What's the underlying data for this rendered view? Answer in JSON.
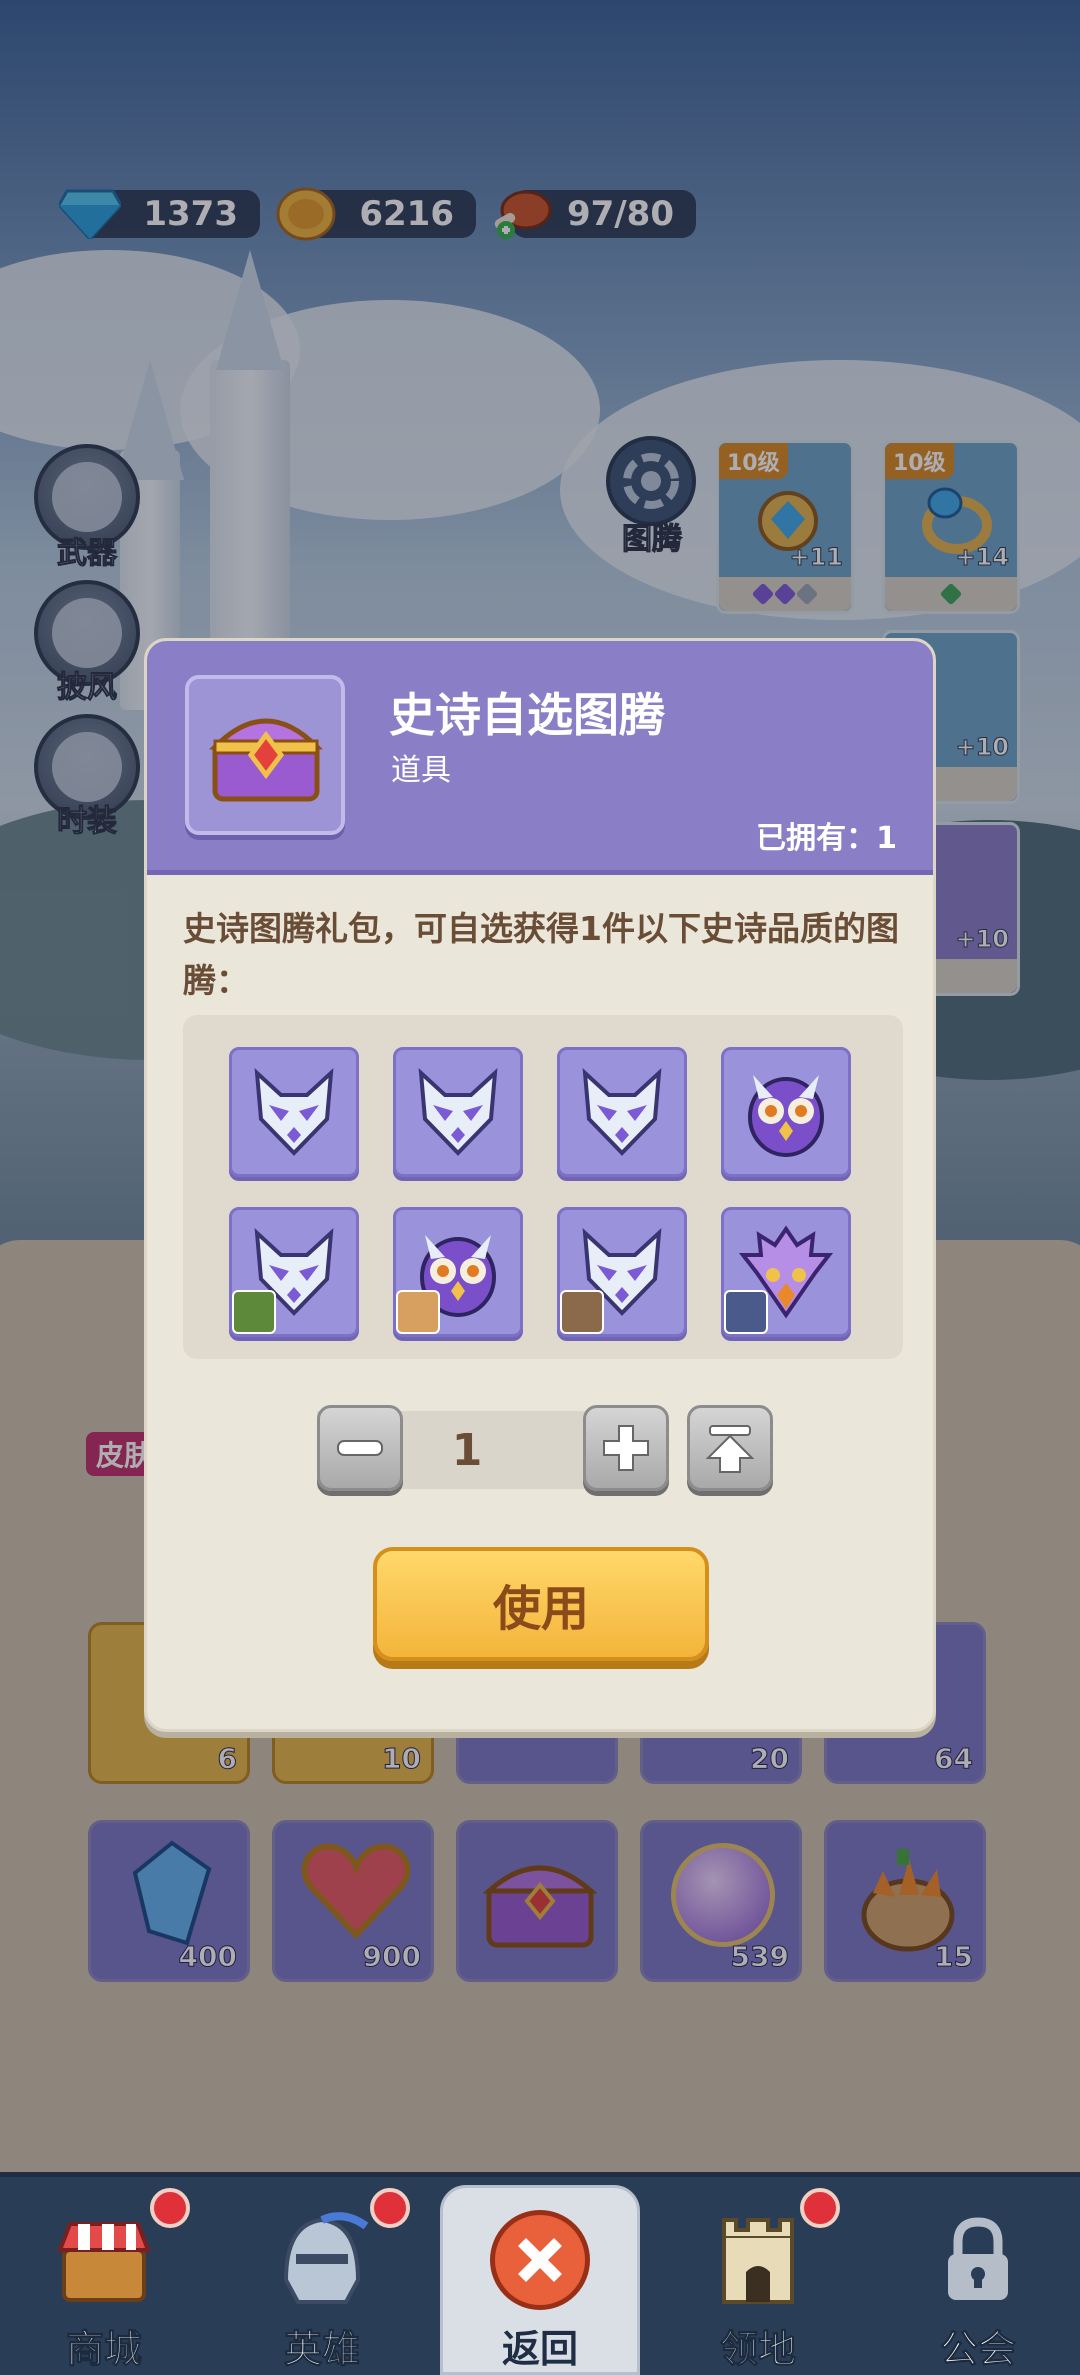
{
  "currency": {
    "diamonds": "1373",
    "coins": "6216",
    "stamina": "97/80"
  },
  "side_menu": [
    {
      "label": "武器",
      "icon": "weapon-icon"
    },
    {
      "label": "披风",
      "icon": "cape-icon"
    },
    {
      "label": "时装",
      "icon": "costume-icon"
    }
  ],
  "totem_button": {
    "label": "图腾",
    "icon": "totem-icon"
  },
  "equipment": [
    {
      "level": "10级",
      "plus": "+11",
      "gems": [
        "#7e5ad6",
        "#7e5ad6",
        "#9aa6b6"
      ]
    },
    {
      "level": "10级",
      "plus": "+14",
      "gems": [
        "#3fa55a"
      ]
    },
    {
      "plus": "+10"
    },
    {
      "plus": "+10"
    }
  ],
  "inventory_visible_counts": [
    "6",
    "10",
    "20",
    "64",
    "400",
    "900",
    "539",
    "15"
  ],
  "inventory_tag": "皮肤",
  "dialog": {
    "title": "史诗自选图腾",
    "subtitle": "道具",
    "owned_label": "已拥有：",
    "owned_value": "1",
    "description": "史诗图腾礼包，可自选获得1件以下史诗品质的图腾：",
    "quantity": "1",
    "use_label": "使用",
    "options": [
      {
        "icon": "fox-mask-icon"
      },
      {
        "icon": "fox-mask-icon"
      },
      {
        "icon": "fox-mask-icon"
      },
      {
        "icon": "owl-mask-icon"
      },
      {
        "icon": "fox-mask-icon",
        "hero": "goblin-hero-avatar"
      },
      {
        "icon": "owl-mask-icon",
        "hero": "lion-hero-avatar"
      },
      {
        "icon": "fox-mask-icon",
        "hero": "raccoon-hero-avatar"
      },
      {
        "icon": "eagle-mask-icon",
        "hero": "warrior-hero-avatar"
      }
    ]
  },
  "nav": [
    {
      "label": "商城",
      "icon": "shop-icon",
      "badge": true
    },
    {
      "label": "英雄",
      "icon": "helmet-icon",
      "badge": true
    },
    {
      "label": "返回",
      "icon": "close-icon",
      "badge": false
    },
    {
      "label": "领地",
      "icon": "castle-icon",
      "badge": true
    },
    {
      "label": "公会",
      "icon": "lock-icon",
      "badge": false
    }
  ],
  "colors": {
    "dialog_header": "#8a7fc6",
    "dialog_body": "#ebe6da",
    "use_button": "#f4b43a",
    "badge": "#e0313a"
  }
}
